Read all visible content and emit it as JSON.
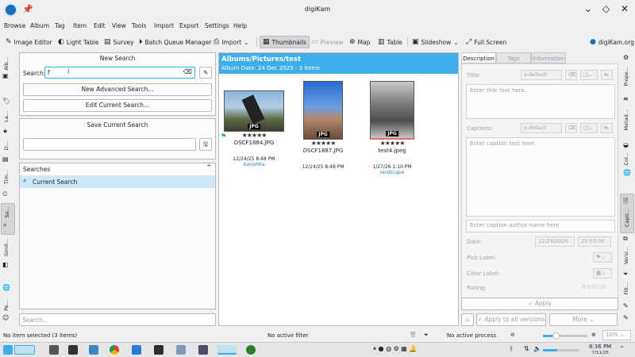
{
  "window": {
    "title": "digiKam"
  },
  "menu": [
    "Browse",
    "Album",
    "Tag",
    "Item",
    "Edit",
    "View",
    "Tools",
    "Import",
    "Export",
    "Settings",
    "Help"
  ],
  "toolbar": {
    "image_editor": "Image Editor",
    "light_table": "Light Table",
    "survey": "Survey",
    "batch_queue": "Batch Queue Manager",
    "import": "Import",
    "thumbnails": "Thumbnails",
    "preview": "Preview",
    "map": "Map",
    "table": "Table",
    "slideshow": "Slideshow",
    "full_screen": "Full Screen",
    "site": "digiKam.org"
  },
  "left_tabs": [
    "Alb...",
    "La...",
    "D...",
    "Tim...",
    "Se...",
    "Simil...",
    "Pe..."
  ],
  "search": {
    "new_search_title": "New Search",
    "search_label": "Search:",
    "search_value": "f",
    "new_advanced": "New Advanced Search...",
    "edit_current": "Edit Current Search...",
    "save_title": "Save Current Search",
    "searches_header": "Searches",
    "current_search": "Current Search",
    "bottom_placeholder": "Search..."
  },
  "album": {
    "path": "Albums/Pictures/test",
    "subtitle": "Album Date: 24 Dec 2025 - 3 Items",
    "items": [
      {
        "badge": "JPG",
        "stars": "★★★★★",
        "name": "DSCF1884.JPG",
        "date": "12/24/25 8:48 PM",
        "tag": "Kanishka"
      },
      {
        "badge": "JPG",
        "stars": "★★★★★",
        "name": "DSCF1887.JPG",
        "date": "12/24/25 8:48 PM",
        "tag": ""
      },
      {
        "badge": "JPG",
        "stars": "★★★★★",
        "name": "test4.jpeg",
        "date": "1/27/26 1:10 PM",
        "tag": "landscape"
      }
    ]
  },
  "right": {
    "tabs": [
      "Description",
      "Tags",
      "Information"
    ],
    "title_label": "Title:",
    "lang_default": "x-default",
    "title_placeholder": "Enter title text here.",
    "captions_label": "Captions:",
    "caption_placeholder": "Enter caption text here.",
    "author_placeholder": "Enter caption author name here.",
    "date_label": "Date:",
    "date_value": "12/24/2025",
    "time_value": "20:53:06",
    "pick_label": "Pick Label:",
    "color_label": "Color Label:",
    "rating_label": "Rating:",
    "rating_stars": "☆☆☆☆☆",
    "apply": "Apply",
    "apply_all": "Apply to all versions",
    "more": "More"
  },
  "right_tabs": [
    "Prope...",
    "Metad...",
    "Col...",
    "Capti...",
    "Versi...",
    "Filt..."
  ],
  "status": {
    "selected": "No item selected (3 items)",
    "filter": "No active filter",
    "process": "No active process",
    "zoom": "10%"
  },
  "taskbar": {
    "time": "8:36 PM",
    "date": "7/11/25"
  }
}
